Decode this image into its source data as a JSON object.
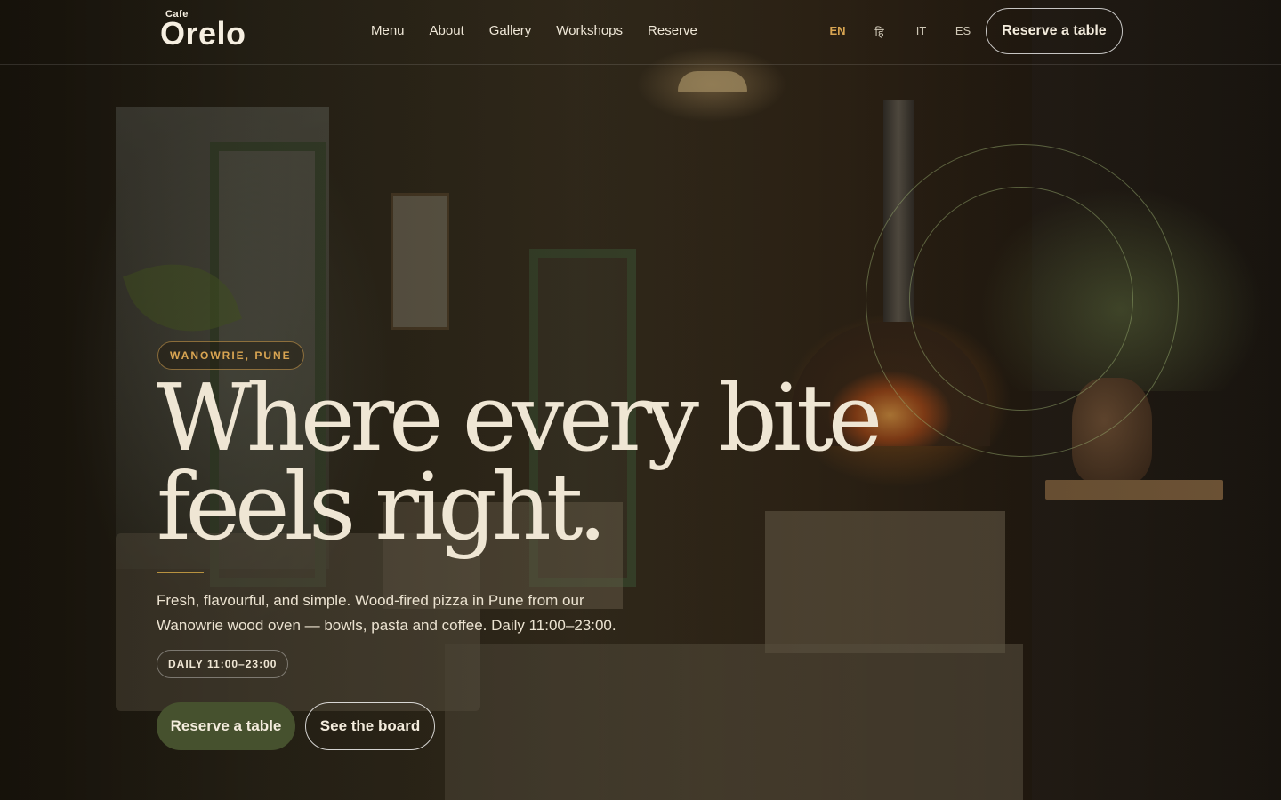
{
  "header": {
    "logo_small": "Cafe",
    "logo_main": "Orelo",
    "nav": [
      "Menu",
      "About",
      "Gallery",
      "Workshops",
      "Reserve"
    ],
    "languages": [
      "EN",
      "हि",
      "IT",
      "ES"
    ],
    "active_language": "EN",
    "cta_label": "Reserve a table"
  },
  "hero": {
    "location": "WANOWRIE, PUNE",
    "title": "Where every bite feels right.",
    "lede": "Fresh, flavourful, and simple. Wood-fired pizza in Pune from our Wanowrie wood oven — bowls, pasta and coffee. Daily 11:00–23:00.",
    "hours": "DAILY 11:00–23:00",
    "primary_cta": "Reserve a table",
    "secondary_cta": "See the board"
  },
  "colors": {
    "accent": "#d9a552",
    "primary_button": "#46512e",
    "text": "#efe6d4"
  }
}
